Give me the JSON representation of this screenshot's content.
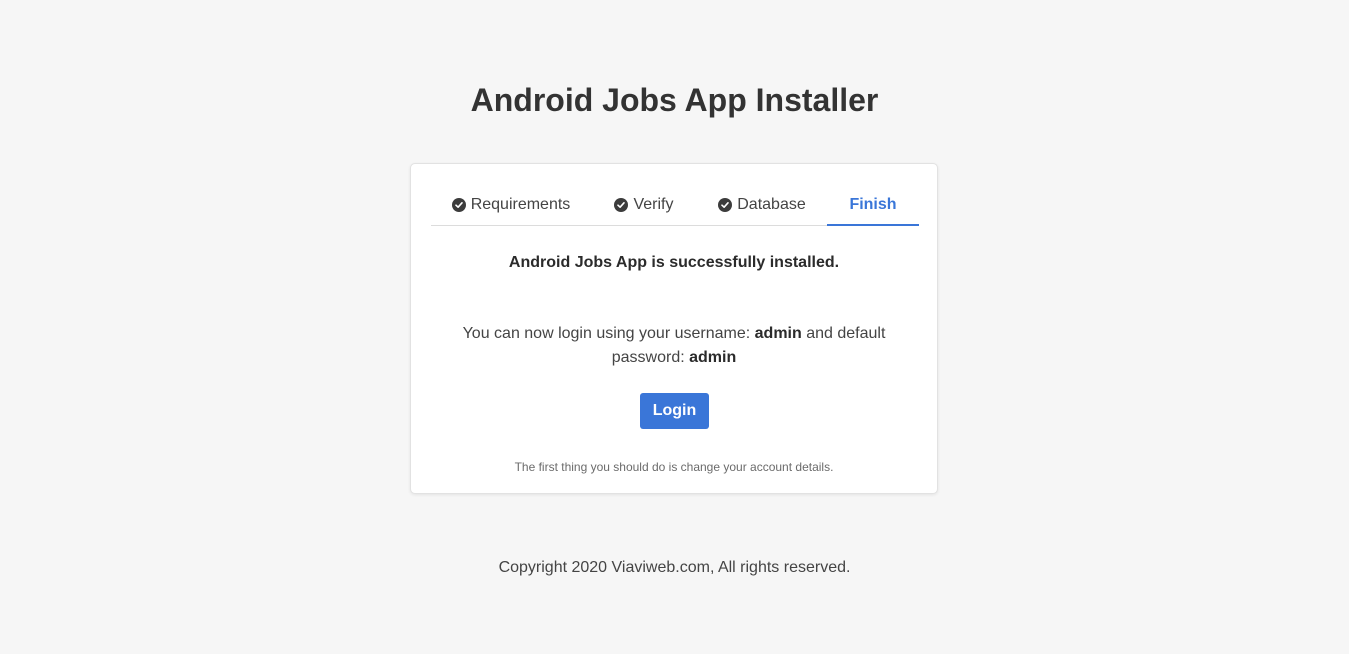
{
  "header": {
    "title": "Android Jobs App Installer"
  },
  "steps": [
    {
      "label": "Requirements",
      "icon": "check-circle-icon",
      "status": "complete"
    },
    {
      "label": "Verify",
      "icon": "check-circle-icon",
      "status": "complete"
    },
    {
      "label": "Database",
      "icon": "check-circle-icon",
      "status": "complete"
    },
    {
      "label": "Finish",
      "status": "active"
    }
  ],
  "content": {
    "success_message": "Android Jobs App is successfully installed.",
    "login_text_prefix": "You can now login using your username:",
    "username": "admin",
    "login_text_middle": "and default password:",
    "password": "admin",
    "login_button_label": "Login",
    "note": "The first thing you should do is change your account details."
  },
  "footer": {
    "copyright": "Copyright 2020 Viaviweb.com, All rights reserved."
  },
  "colors": {
    "accent": "#3a76d8",
    "background": "#f6f6f6",
    "card": "#ffffff"
  }
}
